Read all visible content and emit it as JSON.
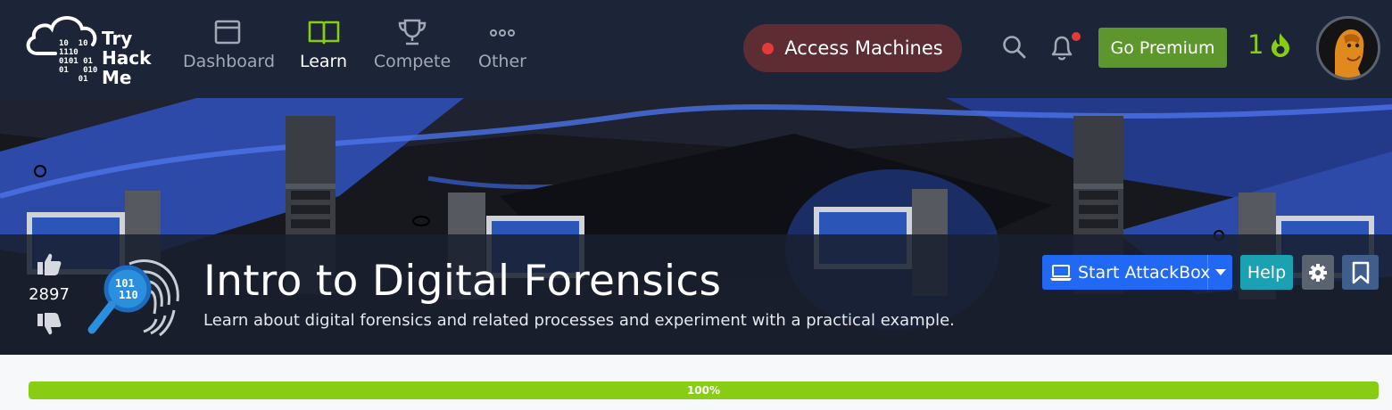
{
  "brand": {
    "name_lines": [
      "Try",
      "Hack",
      "Me"
    ],
    "bits": "10  10\n1110\n0101 01\n01   010\n    01"
  },
  "nav": {
    "items": [
      {
        "label": "Dashboard",
        "icon": "dashboard-window-icon",
        "active": false
      },
      {
        "label": "Learn",
        "icon": "open-book-icon",
        "active": true
      },
      {
        "label": "Compete",
        "icon": "trophy-icon",
        "active": false
      },
      {
        "label": "Other",
        "icon": "more-dots-icon",
        "active": false
      }
    ],
    "access_label": "Access Machines",
    "premium_label": "Go Premium",
    "streak_count": "1",
    "notifications_unread": true
  },
  "room": {
    "title": "Intro to Digital Forensics",
    "description": "Learn about digital forensics and related processes and experiment with a practical example.",
    "votes": "2897",
    "icon": "fingerprint-magnifier-icon"
  },
  "actions": {
    "attackbox_label": "Start AttackBox",
    "help_label": "Help"
  },
  "progress": {
    "value": 1.0,
    "label": "100%"
  },
  "colors": {
    "navbar": "#1c2538",
    "premium": "#5c962c",
    "accent_green": "#88cc14",
    "attackbox": "#2168f5",
    "help": "#1aa1b2",
    "access": "#5e2d33"
  }
}
